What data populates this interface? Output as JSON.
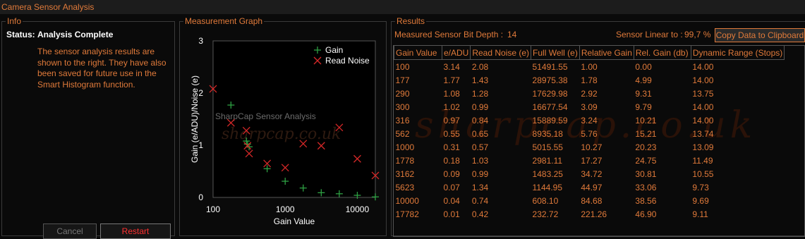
{
  "window": {
    "title": "Camera Sensor Analysis"
  },
  "info": {
    "title": "Info",
    "status_label": "Status:",
    "status_value": "Analysis Complete",
    "message_lines": [
      "The sensor analysis results are",
      "shown to the right. They have also",
      "been saved for future use in the",
      "Smart Histogram function."
    ],
    "cancel_label": "Cancel",
    "restart_label": "Restart"
  },
  "graph": {
    "title": "Measurement Graph",
    "watermark": "SharpCap Sensor Analysis",
    "watermark2": "sharpcap.co.uk"
  },
  "chart_data": {
    "type": "scatter",
    "xlabel": "Gain Value",
    "ylabel": "Gain (e/ADU)/Noise (e)",
    "xscale": "log",
    "xlim": [
      100,
      17782
    ],
    "ylim": [
      0,
      3
    ],
    "xticks": [
      "100",
      "1000",
      "10000"
    ],
    "yticks": [
      "0",
      "1",
      "2",
      "3"
    ],
    "legend_position": "top-right",
    "series": [
      {
        "name": "Gain",
        "marker": "+",
        "color": "#2ea043",
        "x": [
          100,
          177,
          290,
          300,
          316,
          562,
          1000,
          1778,
          3162,
          5623,
          10000,
          17782
        ],
        "y": [
          3.14,
          1.77,
          1.08,
          1.02,
          0.97,
          0.55,
          0.31,
          0.18,
          0.09,
          0.07,
          0.04,
          0.01
        ]
      },
      {
        "name": "Read Noise",
        "marker": "x",
        "color": "#d62828",
        "x": [
          100,
          177,
          290,
          300,
          316,
          562,
          1000,
          1778,
          3162,
          5623,
          10000,
          17782
        ],
        "y": [
          2.08,
          1.43,
          1.28,
          0.99,
          0.84,
          0.65,
          0.57,
          1.03,
          0.99,
          1.34,
          0.74,
          0.42
        ]
      }
    ]
  },
  "results": {
    "title": "Results",
    "bit_depth_label": "Measured Sensor Bit Depth :",
    "bit_depth_value": "14",
    "linear_label": "Sensor Linear to :",
    "linear_value": "99,7 %",
    "copy_label": "Copy Data to Clipboard",
    "watermark": "sharpcap.co.uk",
    "columns": [
      "Gain Value",
      "e/ADU",
      "Read Noise (e)",
      "Full Well (e)",
      "Relative Gain",
      "Rel. Gain (db)",
      "Dynamic Range (Stops)"
    ],
    "rows": [
      [
        "100",
        "3.14",
        "2.08",
        "51491.55",
        "1.00",
        "0.00",
        "14.00"
      ],
      [
        "177",
        "1.77",
        "1.43",
        "28975.38",
        "1.78",
        "4.99",
        "14.00"
      ],
      [
        "290",
        "1.08",
        "1.28",
        "17629.98",
        "2.92",
        "9.31",
        "13.75"
      ],
      [
        "300",
        "1.02",
        "0.99",
        "16677.54",
        "3.09",
        "9.79",
        "14.00"
      ],
      [
        "316",
        "0.97",
        "0.84",
        "15889.59",
        "3.24",
        "10.21",
        "14.00"
      ],
      [
        "562",
        "0.55",
        "0.65",
        "8935.18",
        "5.76",
        "15.21",
        "13.74"
      ],
      [
        "1000",
        "0.31",
        "0.57",
        "5015.55",
        "10.27",
        "20.23",
        "13.09"
      ],
      [
        "1778",
        "0.18",
        "1.03",
        "2981.11",
        "17.27",
        "24.75",
        "11.49"
      ],
      [
        "3162",
        "0.09",
        "0.99",
        "1483.25",
        "34.72",
        "30.81",
        "10.55"
      ],
      [
        "5623",
        "0.07",
        "1.34",
        "1144.95",
        "44.97",
        "33.06",
        "9.73"
      ],
      [
        "10000",
        "0.04",
        "0.74",
        "608.10",
        "84.68",
        "38.56",
        "9.69"
      ],
      [
        "17782",
        "0.01",
        "0.42",
        "232.72",
        "221.26",
        "46.90",
        "9.11"
      ]
    ]
  }
}
